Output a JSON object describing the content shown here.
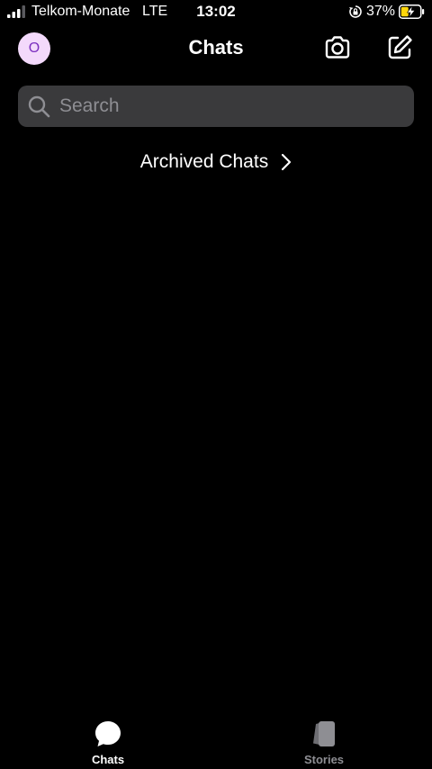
{
  "status_bar": {
    "carrier": "Telkom-Monate",
    "network": "LTE",
    "time": "13:02",
    "battery_percent": "37%"
  },
  "header": {
    "avatar_initial": "O",
    "title": "Chats"
  },
  "search": {
    "placeholder": "Search"
  },
  "archived": {
    "label": "Archived Chats"
  },
  "tabs": [
    {
      "label": "Chats",
      "icon": "chat-bubble-icon",
      "active": true
    },
    {
      "label": "Stories",
      "icon": "stories-icon",
      "active": false
    }
  ],
  "colors": {
    "background": "#000000",
    "search_bg": "#3a3a3c",
    "avatar_bg": "#f3d9fb",
    "avatar_text": "#7b2fbf",
    "battery_charging": "#ffd60a",
    "inactive": "#8e8e93"
  }
}
